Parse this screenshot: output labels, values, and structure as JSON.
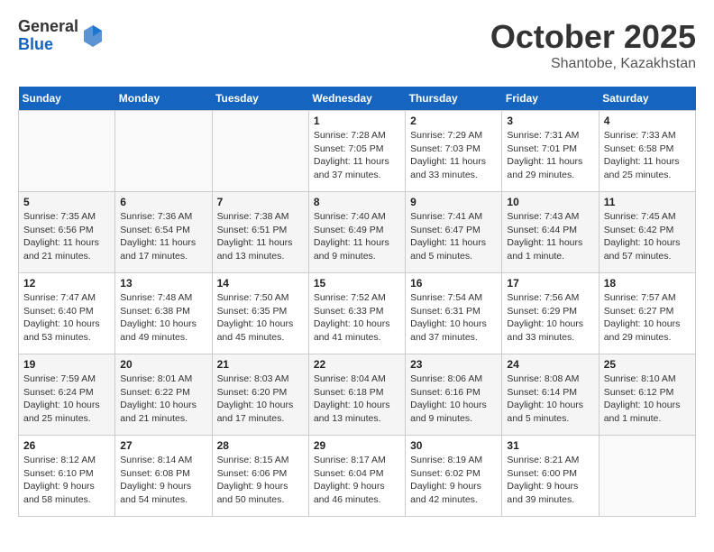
{
  "header": {
    "logo_general": "General",
    "logo_blue": "Blue",
    "month": "October 2025",
    "location": "Shantobe, Kazakhstan"
  },
  "weekdays": [
    "Sunday",
    "Monday",
    "Tuesday",
    "Wednesday",
    "Thursday",
    "Friday",
    "Saturday"
  ],
  "weeks": [
    [
      {
        "day": "",
        "info": ""
      },
      {
        "day": "",
        "info": ""
      },
      {
        "day": "",
        "info": ""
      },
      {
        "day": "1",
        "info": "Sunrise: 7:28 AM\nSunset: 7:05 PM\nDaylight: 11 hours and 37 minutes."
      },
      {
        "day": "2",
        "info": "Sunrise: 7:29 AM\nSunset: 7:03 PM\nDaylight: 11 hours and 33 minutes."
      },
      {
        "day": "3",
        "info": "Sunrise: 7:31 AM\nSunset: 7:01 PM\nDaylight: 11 hours and 29 minutes."
      },
      {
        "day": "4",
        "info": "Sunrise: 7:33 AM\nSunset: 6:58 PM\nDaylight: 11 hours and 25 minutes."
      }
    ],
    [
      {
        "day": "5",
        "info": "Sunrise: 7:35 AM\nSunset: 6:56 PM\nDaylight: 11 hours and 21 minutes."
      },
      {
        "day": "6",
        "info": "Sunrise: 7:36 AM\nSunset: 6:54 PM\nDaylight: 11 hours and 17 minutes."
      },
      {
        "day": "7",
        "info": "Sunrise: 7:38 AM\nSunset: 6:51 PM\nDaylight: 11 hours and 13 minutes."
      },
      {
        "day": "8",
        "info": "Sunrise: 7:40 AM\nSunset: 6:49 PM\nDaylight: 11 hours and 9 minutes."
      },
      {
        "day": "9",
        "info": "Sunrise: 7:41 AM\nSunset: 6:47 PM\nDaylight: 11 hours and 5 minutes."
      },
      {
        "day": "10",
        "info": "Sunrise: 7:43 AM\nSunset: 6:44 PM\nDaylight: 11 hours and 1 minute."
      },
      {
        "day": "11",
        "info": "Sunrise: 7:45 AM\nSunset: 6:42 PM\nDaylight: 10 hours and 57 minutes."
      }
    ],
    [
      {
        "day": "12",
        "info": "Sunrise: 7:47 AM\nSunset: 6:40 PM\nDaylight: 10 hours and 53 minutes."
      },
      {
        "day": "13",
        "info": "Sunrise: 7:48 AM\nSunset: 6:38 PM\nDaylight: 10 hours and 49 minutes."
      },
      {
        "day": "14",
        "info": "Sunrise: 7:50 AM\nSunset: 6:35 PM\nDaylight: 10 hours and 45 minutes."
      },
      {
        "day": "15",
        "info": "Sunrise: 7:52 AM\nSunset: 6:33 PM\nDaylight: 10 hours and 41 minutes."
      },
      {
        "day": "16",
        "info": "Sunrise: 7:54 AM\nSunset: 6:31 PM\nDaylight: 10 hours and 37 minutes."
      },
      {
        "day": "17",
        "info": "Sunrise: 7:56 AM\nSunset: 6:29 PM\nDaylight: 10 hours and 33 minutes."
      },
      {
        "day": "18",
        "info": "Sunrise: 7:57 AM\nSunset: 6:27 PM\nDaylight: 10 hours and 29 minutes."
      }
    ],
    [
      {
        "day": "19",
        "info": "Sunrise: 7:59 AM\nSunset: 6:24 PM\nDaylight: 10 hours and 25 minutes."
      },
      {
        "day": "20",
        "info": "Sunrise: 8:01 AM\nSunset: 6:22 PM\nDaylight: 10 hours and 21 minutes."
      },
      {
        "day": "21",
        "info": "Sunrise: 8:03 AM\nSunset: 6:20 PM\nDaylight: 10 hours and 17 minutes."
      },
      {
        "day": "22",
        "info": "Sunrise: 8:04 AM\nSunset: 6:18 PM\nDaylight: 10 hours and 13 minutes."
      },
      {
        "day": "23",
        "info": "Sunrise: 8:06 AM\nSunset: 6:16 PM\nDaylight: 10 hours and 9 minutes."
      },
      {
        "day": "24",
        "info": "Sunrise: 8:08 AM\nSunset: 6:14 PM\nDaylight: 10 hours and 5 minutes."
      },
      {
        "day": "25",
        "info": "Sunrise: 8:10 AM\nSunset: 6:12 PM\nDaylight: 10 hours and 1 minute."
      }
    ],
    [
      {
        "day": "26",
        "info": "Sunrise: 8:12 AM\nSunset: 6:10 PM\nDaylight: 9 hours and 58 minutes."
      },
      {
        "day": "27",
        "info": "Sunrise: 8:14 AM\nSunset: 6:08 PM\nDaylight: 9 hours and 54 minutes."
      },
      {
        "day": "28",
        "info": "Sunrise: 8:15 AM\nSunset: 6:06 PM\nDaylight: 9 hours and 50 minutes."
      },
      {
        "day": "29",
        "info": "Sunrise: 8:17 AM\nSunset: 6:04 PM\nDaylight: 9 hours and 46 minutes."
      },
      {
        "day": "30",
        "info": "Sunrise: 8:19 AM\nSunset: 6:02 PM\nDaylight: 9 hours and 42 minutes."
      },
      {
        "day": "31",
        "info": "Sunrise: 8:21 AM\nSunset: 6:00 PM\nDaylight: 9 hours and 39 minutes."
      },
      {
        "day": "",
        "info": ""
      }
    ]
  ]
}
